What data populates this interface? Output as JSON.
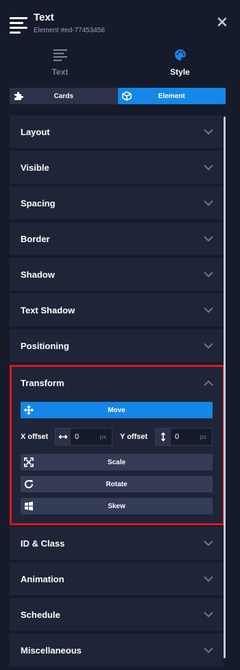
{
  "header": {
    "title": "Text",
    "subtitle": "Element #ed-77453456"
  },
  "modes": [
    {
      "label": "Text",
      "icon": "lines-icon",
      "active": false
    },
    {
      "label": "Style",
      "icon": "palette-icon",
      "active": true
    }
  ],
  "segments": [
    {
      "label": "Cards",
      "icon": "puzzle-icon",
      "active": false
    },
    {
      "label": "Element",
      "icon": "cube-icon",
      "active": true
    }
  ],
  "sections": {
    "layout": "Layout",
    "visible": "Visible",
    "spacing": "Spacing",
    "border": "Border",
    "shadow": "Shadow",
    "text_shadow": "Text Shadow",
    "positioning": "Positioning",
    "id_class": "ID & Class",
    "animation": "Animation",
    "schedule": "Schedule",
    "miscellaneous": "Miscellaneous"
  },
  "transform": {
    "label": "Transform",
    "move_label": "Move",
    "x_offset_label": "X offset",
    "x_offset_value": "0",
    "y_offset_label": "Y offset",
    "y_offset_value": "0",
    "unit": "px",
    "scale_label": "Scale",
    "rotate_label": "Rotate",
    "skew_label": "Skew"
  },
  "colors": {
    "accent": "#1587e8",
    "highlight": "#e3141c",
    "panel": "#1f2538",
    "background": "#161b2b"
  }
}
